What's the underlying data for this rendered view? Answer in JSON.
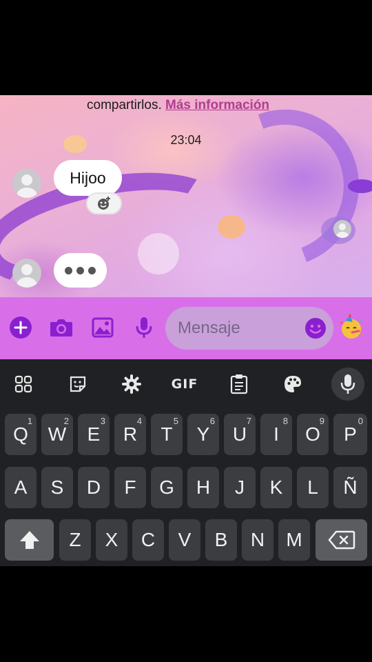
{
  "chat": {
    "info_text": "compartirlos.",
    "info_link": "Más información",
    "timestamp": "23:04",
    "messages": [
      {
        "text": "Hijoo"
      }
    ]
  },
  "composer": {
    "placeholder": "Mensaje",
    "icons": [
      "plus-icon",
      "camera-icon",
      "gallery-icon",
      "microphone-icon",
      "smiley-icon",
      "party-emoji-icon"
    ]
  },
  "keyboard": {
    "toolbar": {
      "gif_label": "GIF"
    },
    "row1": [
      {
        "label": "Q",
        "hint": "1"
      },
      {
        "label": "W",
        "hint": "2"
      },
      {
        "label": "E",
        "hint": "3"
      },
      {
        "label": "R",
        "hint": "4"
      },
      {
        "label": "T",
        "hint": "5"
      },
      {
        "label": "Y",
        "hint": "6"
      },
      {
        "label": "U",
        "hint": "7"
      },
      {
        "label": "I",
        "hint": "8"
      },
      {
        "label": "O",
        "hint": "9"
      },
      {
        "label": "P",
        "hint": "0"
      }
    ],
    "row2": [
      "A",
      "S",
      "D",
      "F",
      "G",
      "H",
      "J",
      "K",
      "L",
      "Ñ"
    ],
    "row3": [
      "Z",
      "X",
      "C",
      "V",
      "B",
      "N",
      "M"
    ]
  },
  "colors": {
    "accent": "#8a1fd0",
    "input_bar": "#d86fe8",
    "keyboard_bg": "#202124",
    "key_bg": "#3c3d41",
    "link": "#b23c8f"
  }
}
